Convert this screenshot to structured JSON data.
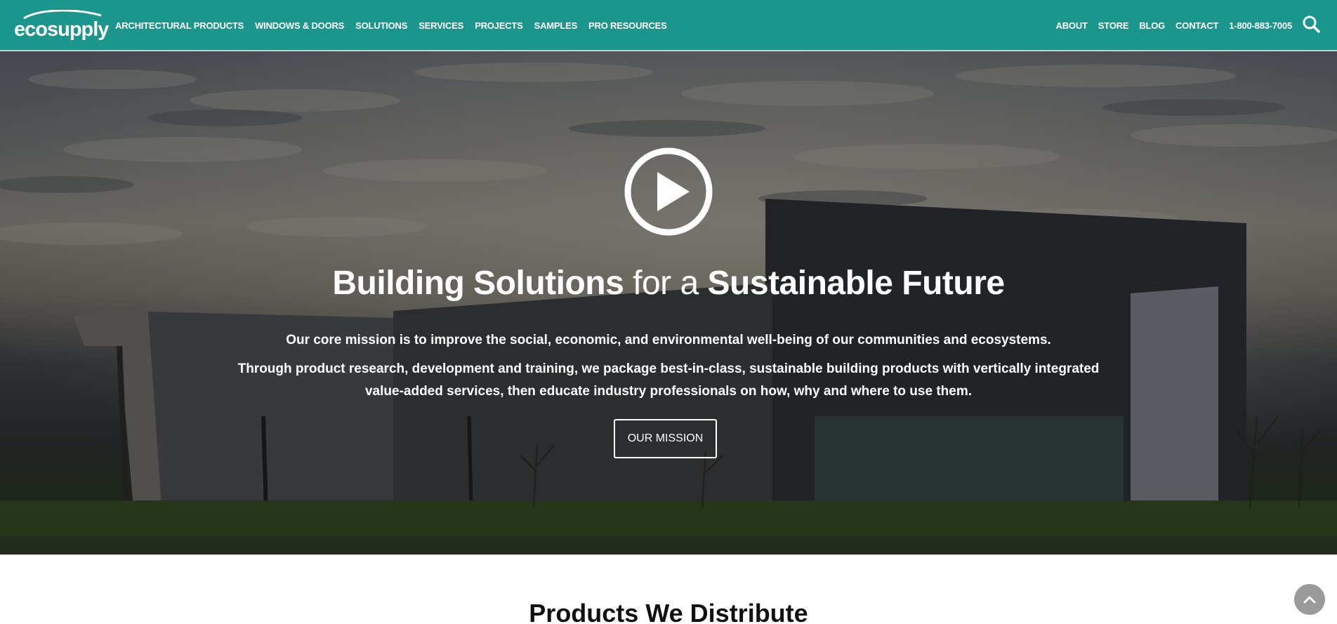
{
  "brand": {
    "logo_text": "ecosupply"
  },
  "nav": {
    "left": [
      {
        "label": "Architectural Products"
      },
      {
        "label": "Windows & Doors"
      },
      {
        "label": "Solutions"
      },
      {
        "label": "Services"
      },
      {
        "label": "Projects"
      },
      {
        "label": "Samples"
      },
      {
        "label": "Pro Resources"
      }
    ],
    "right": [
      {
        "label": "About"
      },
      {
        "label": "Store"
      },
      {
        "label": "Blog"
      },
      {
        "label": "Contact"
      },
      {
        "label": "1-800-883-7005"
      }
    ],
    "search_icon": "search-icon"
  },
  "hero": {
    "title_part1": "Building Solutions",
    "title_part2": " for a ",
    "title_part3": "Sustainable Future",
    "mission": "Our core mission is to improve the social, economic, and environmental well-being of our communities and ecosystems.",
    "description": "Through product research, development and training, we package best-in-class, sustainable building products with vertically integrated value-added services, then educate industry professionals on how, why and where to use them.",
    "button_label": "OUR MISSION",
    "play_icon": "play-icon"
  },
  "products": {
    "title": "Products We Distribute"
  },
  "colors": {
    "header": "#1a968c",
    "text_light": "#ffffff",
    "scroll_button": "#9a9a9a"
  }
}
